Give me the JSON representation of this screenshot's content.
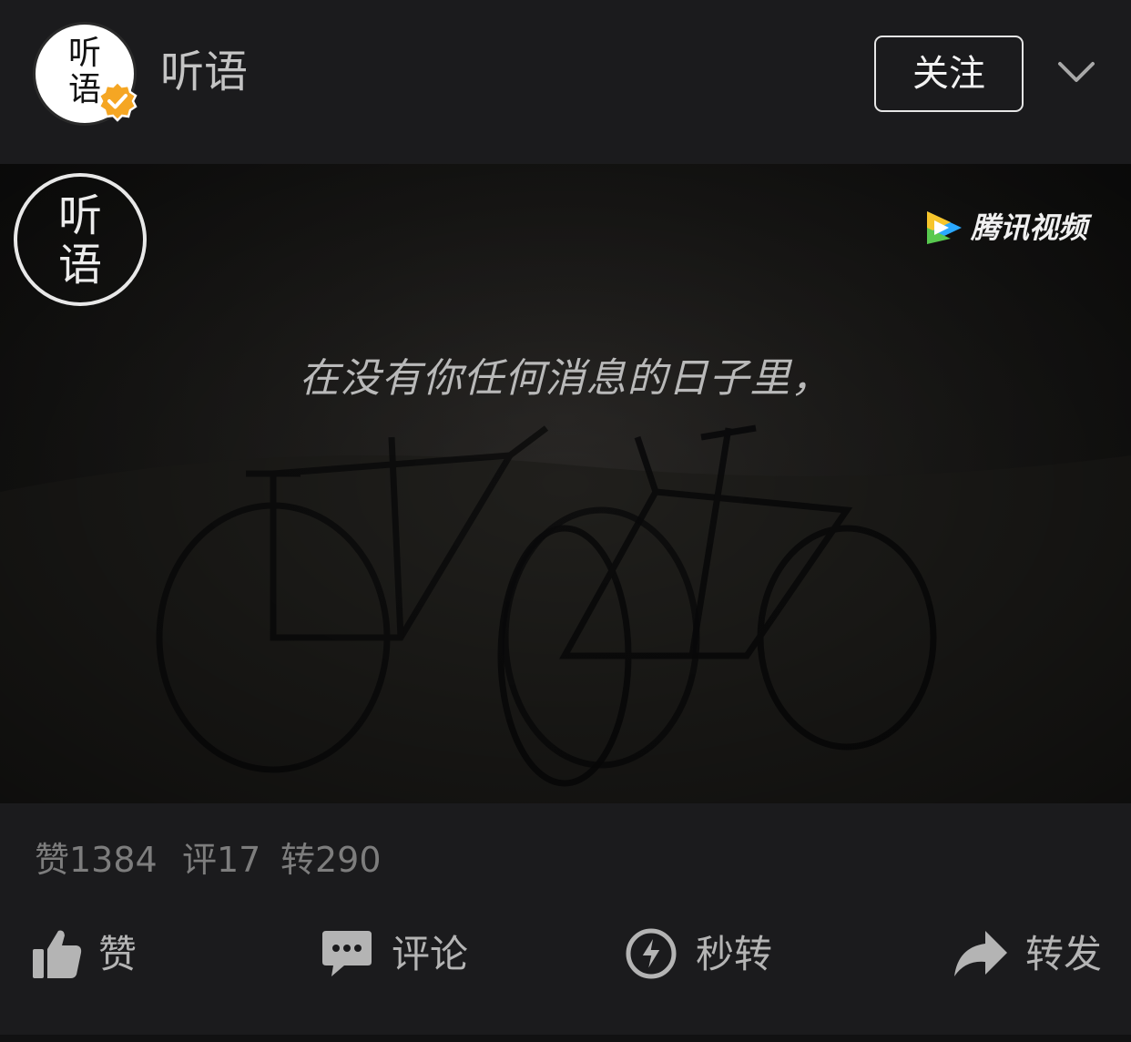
{
  "header": {
    "avatar_text": "听\n语",
    "username": "听语",
    "follow_label": "关注"
  },
  "video": {
    "logo_text": "听\n语",
    "brand_text": "腾讯视频",
    "subtitle": "在没有你任何消息的日子里，"
  },
  "stats": {
    "likes": "赞1384",
    "comments": "评17",
    "reposts": "转290"
  },
  "actions": {
    "like_label": "赞",
    "comment_label": "评论",
    "quick_repost_label": "秒转",
    "forward_label": "转发"
  },
  "colors": {
    "background": "#1b1b1d",
    "verified_badge": "#f5a623",
    "text_primary": "#f2f2f2",
    "text_secondary": "#b4b4b4",
    "text_muted": "#7d7d7d"
  },
  "icons": [
    "verified-badge-icon",
    "chevron-down-icon",
    "tencent-video-icon",
    "thumbs-up-icon",
    "comment-icon",
    "lightning-icon",
    "share-arrow-icon"
  ]
}
